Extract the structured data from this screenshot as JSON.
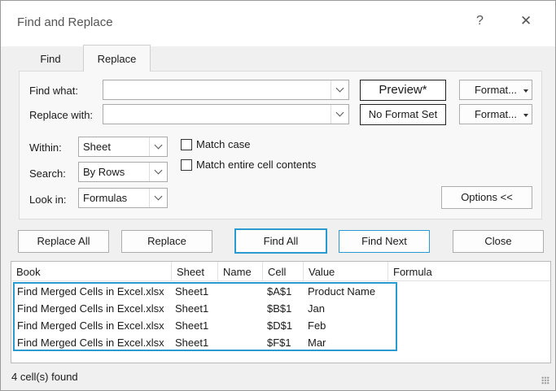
{
  "window": {
    "title": "Find and Replace",
    "help": "?",
    "close": "✕"
  },
  "tabs": [
    {
      "label": "Find"
    },
    {
      "label": "Replace"
    }
  ],
  "form": {
    "find_label": "Find what:",
    "find_value": "",
    "replace_label": "Replace with:",
    "replace_value": "",
    "preview_label": "Preview*",
    "no_format_label": "No Format Set",
    "format_label": "Format...",
    "within_label": "Within:",
    "within_value": "Sheet",
    "search_label": "Search:",
    "search_value": "By Rows",
    "lookin_label": "Look in:",
    "lookin_value": "Formulas",
    "match_case_label": "Match case",
    "match_case_checked": false,
    "match_entire_label": "Match entire cell contents",
    "match_entire_checked": false,
    "options_label": "Options <<"
  },
  "actions": {
    "replace_all": "Replace All",
    "replace": "Replace",
    "find_all": "Find All",
    "find_next": "Find Next",
    "close": "Close"
  },
  "results": {
    "columns": [
      "Book",
      "Sheet",
      "Name",
      "Cell",
      "Value",
      "Formula"
    ],
    "rows": [
      {
        "book": "Find Merged Cells in Excel.xlsx",
        "sheet": "Sheet1",
        "name": "",
        "cell": "$A$1",
        "value": "Product Name",
        "formula": ""
      },
      {
        "book": "Find Merged Cells in Excel.xlsx",
        "sheet": "Sheet1",
        "name": "",
        "cell": "$B$1",
        "value": "Jan",
        "formula": ""
      },
      {
        "book": "Find Merged Cells in Excel.xlsx",
        "sheet": "Sheet1",
        "name": "",
        "cell": "$D$1",
        "value": "Feb",
        "formula": ""
      },
      {
        "book": "Find Merged Cells in Excel.xlsx",
        "sheet": "Sheet1",
        "name": "",
        "cell": "$F$1",
        "value": "Mar",
        "formula": ""
      }
    ]
  },
  "status": {
    "text": "4 cell(s) found"
  },
  "colors": {
    "accent": "#2a9bd0",
    "dialog_bg": "#f0f0f0"
  }
}
